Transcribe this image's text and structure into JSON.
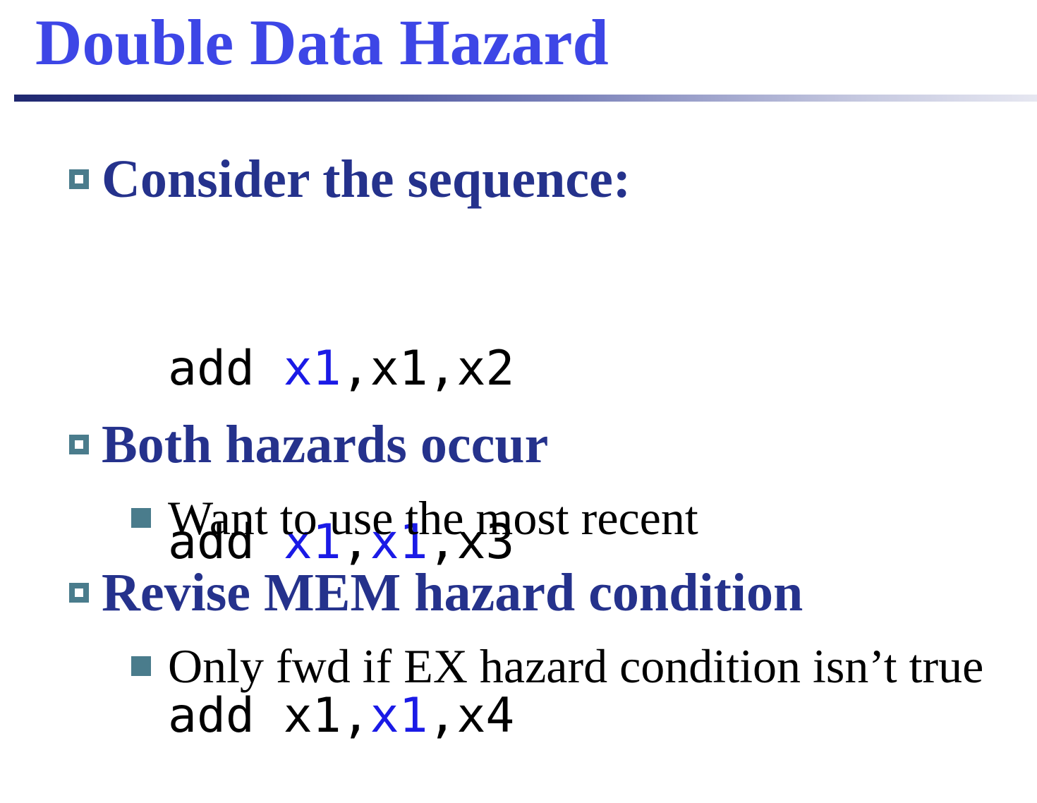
{
  "slide": {
    "title": "Double Data Hazard",
    "colors": {
      "title": "#3d46e6",
      "bullet_text": "#25328c",
      "bullet_marker": "#4a7c8c",
      "code_highlight": "#1a1ae6"
    },
    "bullets": [
      {
        "text": "Consider the sequence:",
        "marker": "hollow-square-icon"
      },
      {
        "text": "Both hazards occur",
        "marker": "hollow-square-icon",
        "sub": {
          "text": "Want to use the most recent",
          "marker": "filled-square-icon"
        }
      },
      {
        "text": "Revise MEM hazard condition",
        "marker": "hollow-square-icon",
        "sub": {
          "text": "Only fwd if EX hazard condition isn’t true",
          "marker": "filled-square-icon"
        }
      }
    ],
    "code": [
      {
        "op": "add",
        "rd": "x1",
        "rs1": "x1",
        "rs2": "x2",
        "highlight": [
          "rd"
        ]
      },
      {
        "op": "add",
        "rd": "x1",
        "rs1": "x1",
        "rs2": "x3",
        "highlight": [
          "rd",
          "rs1"
        ]
      },
      {
        "op": "add",
        "rd": "x1",
        "rs1": "x1",
        "rs2": "x4",
        "highlight": [
          "rs1"
        ]
      }
    ]
  }
}
